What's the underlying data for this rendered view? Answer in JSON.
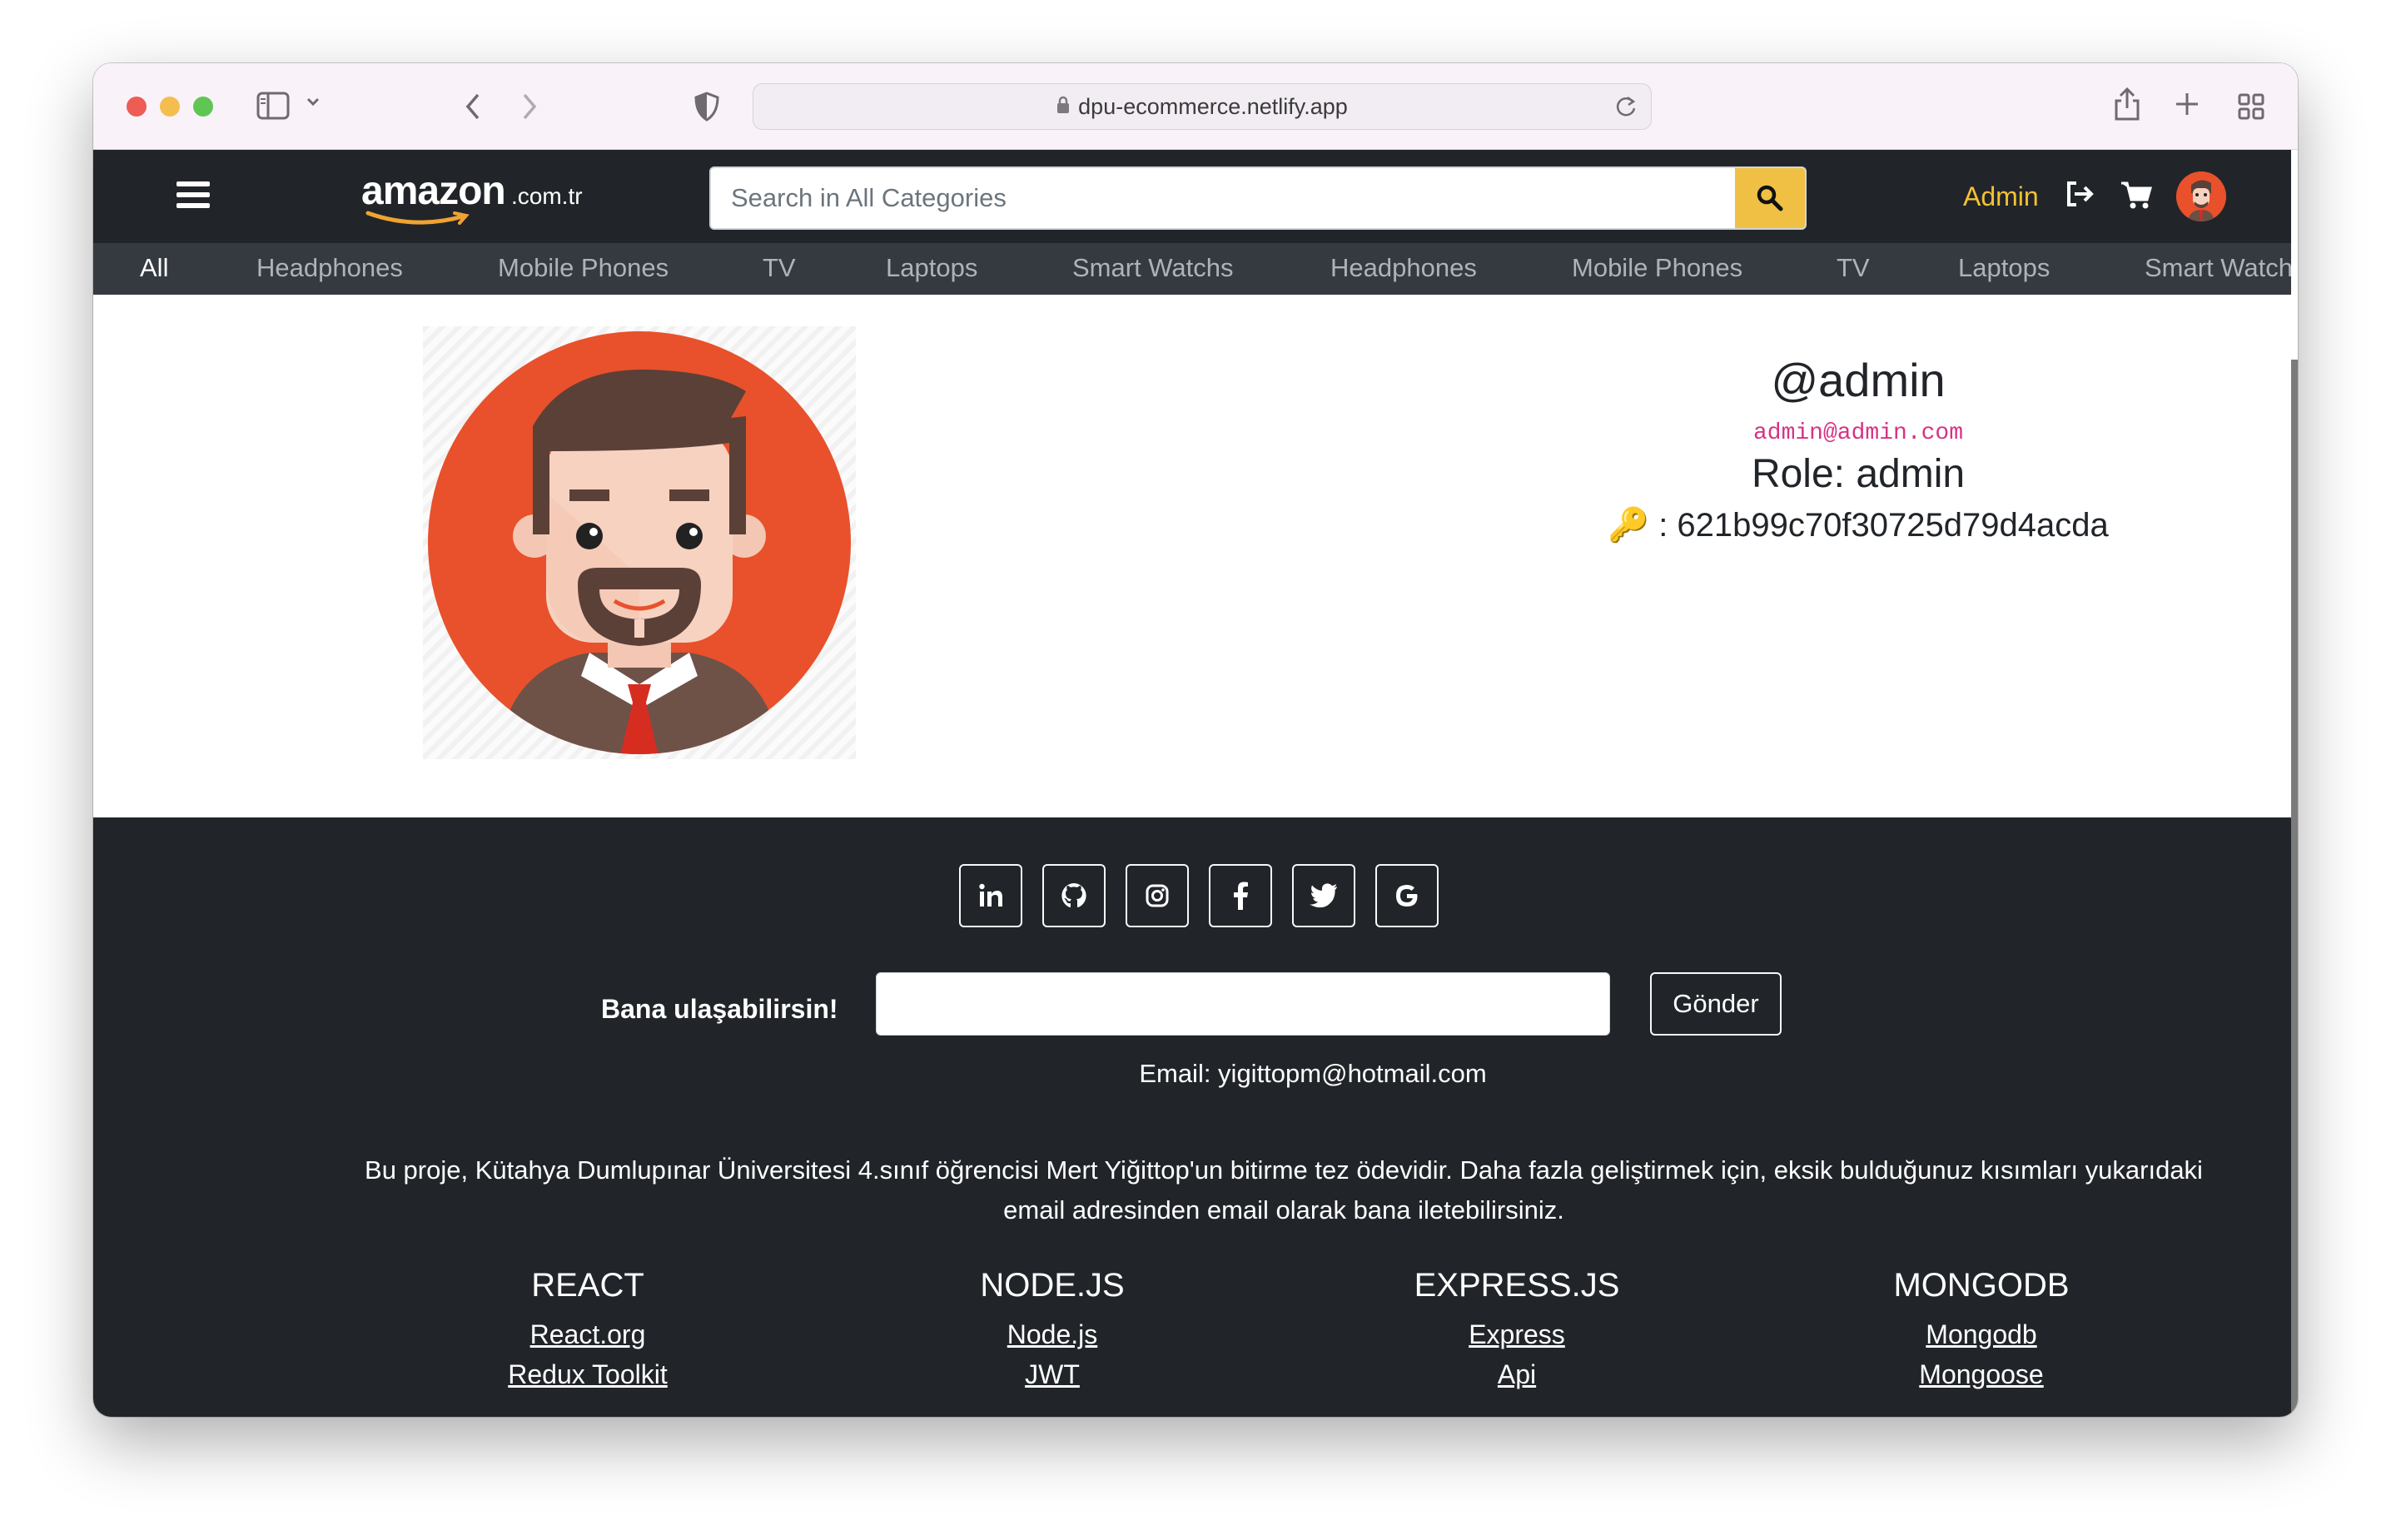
{
  "browser": {
    "url": "dpu-ecommerce.netlify.app"
  },
  "header": {
    "logo_main": "amazon",
    "logo_tld": ".com.tr",
    "search_placeholder": "Search in All Categories",
    "admin_label": "Admin"
  },
  "categories": [
    "All",
    "Headphones",
    "Mobile Phones",
    "TV",
    "Laptops",
    "Smart Watchs",
    "Headphones",
    "Mobile Phones",
    "TV",
    "Laptops",
    "Smart Watchs"
  ],
  "profile": {
    "username": "@admin",
    "email": "admin@admin.com",
    "role": "Role: admin",
    "key_icon": "🔑",
    "id_line": " : 621b99c70f30725d79d4acda"
  },
  "footer": {
    "socials": [
      "linkedin-icon",
      "github-icon",
      "instagram-icon",
      "facebook-icon",
      "twitter-icon",
      "google-icon"
    ],
    "contact_label": "Bana ulaşabilirsin!",
    "send_label": "Gönder",
    "email_line": "Email: yigittopm@hotmail.com",
    "description": "Bu proje, Kütahya Dumlupınar Üniversitesi 4.sınıf öğrencisi Mert Yiğittop'un bitirme tez ödevidir. Daha fazla geliştirmek için, eksik bulduğunuz kısımları yukarıdaki email adresinden email olarak bana iletebilirsiniz.",
    "tech": [
      {
        "title": "REACT",
        "links": [
          "React.org",
          "Redux Toolkit"
        ]
      },
      {
        "title": "NODE.JS",
        "links": [
          "Node.js",
          "JWT"
        ]
      },
      {
        "title": "EXPRESS.JS",
        "links": [
          "Express",
          "Api"
        ]
      },
      {
        "title": "MONGODB",
        "links": [
          "Mongodb",
          "Mongoose"
        ]
      }
    ]
  },
  "colors": {
    "header_bg": "#212529",
    "nav_bg": "#353a40",
    "accent": "#f0c045",
    "admin_text": "#f5c133",
    "avatar_bg": "#e8512b",
    "email_code": "#d63384"
  }
}
